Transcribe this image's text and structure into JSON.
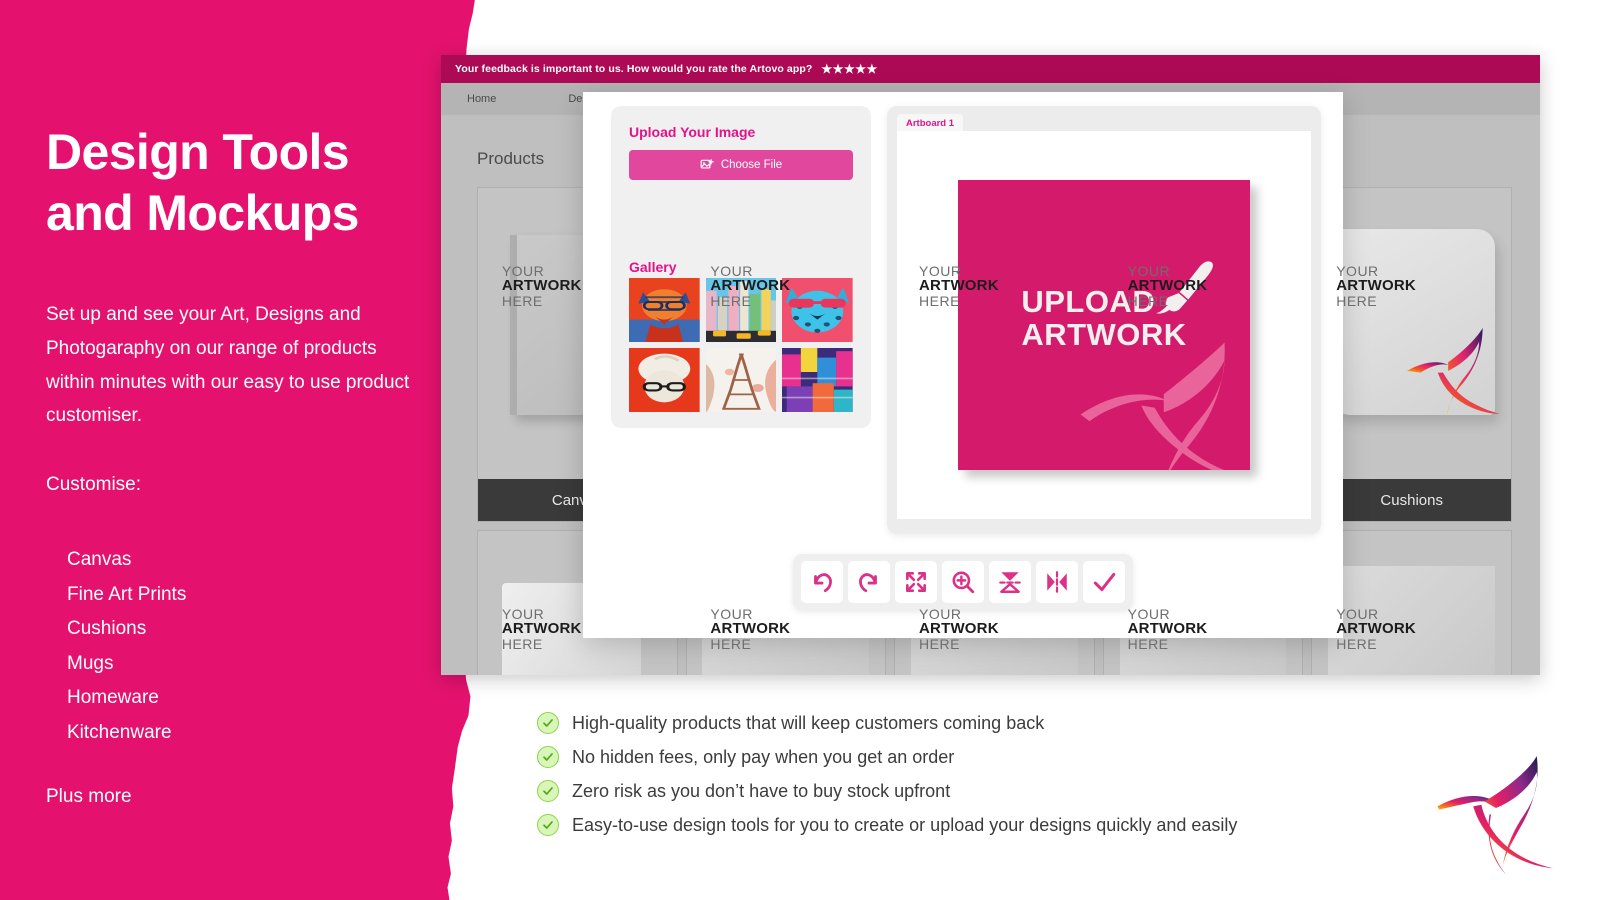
{
  "hero": {
    "title_line1": "Design Tools",
    "title_line2": "and Mockups",
    "body": "Set up and see your Art, Designs and Photogaraphy on our range of products within minutes with our easy to use product customiser.",
    "customise_label": "Customise:",
    "products": [
      "Canvas",
      "Fine Art Prints",
      "Cushions",
      "Mugs",
      "Homeware",
      "Kitchenware"
    ],
    "plus_more": "Plus more",
    "background_color": "#E4126E",
    "text_color": "#FFFFFF"
  },
  "app": {
    "feedback_bar": {
      "message": "Your feedback is important to us. How would you rate the Artovo app?",
      "stars": "★★★★★",
      "background_color": "#AD0A55"
    },
    "nav": {
      "items": [
        {
          "label": "Home"
        },
        {
          "label": "Designs"
        }
      ]
    },
    "products_heading": "Products",
    "artwork_placeholder": {
      "line1": "YOUR",
      "line2": "ARTWORK",
      "line3": "HERE"
    },
    "product_cards": [
      {
        "label": "Canvas",
        "mock": "canvas"
      },
      {
        "label": "",
        "mock": "generic"
      },
      {
        "label": "",
        "mock": "generic"
      },
      {
        "label": "",
        "mock": "generic"
      },
      {
        "label": "Cushions",
        "mock": "cushion"
      },
      {
        "label": "",
        "mock": "mug"
      },
      {
        "label": "",
        "mock": "generic"
      },
      {
        "label": "",
        "mock": "generic"
      },
      {
        "label": "",
        "mock": "generic"
      },
      {
        "label": "",
        "mock": "generic"
      }
    ]
  },
  "editor": {
    "upload": {
      "heading": "Upload Your Image",
      "choose_file_label": "Choose File",
      "button_color": "#E0479D"
    },
    "gallery": {
      "heading": "Gallery",
      "thumbnails": [
        {
          "name": "tiger-in-glasses"
        },
        {
          "name": "new-york-cityscape"
        },
        {
          "name": "blue-leopard-sunglasses"
        },
        {
          "name": "portrait-on-red"
        },
        {
          "name": "eiffel-tower-watercolour"
        },
        {
          "name": "abstract-city-collage"
        }
      ]
    },
    "artboard": {
      "tab_label": "Artboard 1",
      "canvas_line1": "UPLOAD",
      "canvas_line2": "ARTWORK",
      "canvas_color": "#D41A6A"
    },
    "toolbar": {
      "tools": [
        {
          "name": "undo",
          "title": "Undo"
        },
        {
          "name": "redo",
          "title": "Redo"
        },
        {
          "name": "expand",
          "title": "Fit to screen"
        },
        {
          "name": "zoom-in",
          "title": "Zoom in"
        },
        {
          "name": "flip-vertical",
          "title": "Flip vertical"
        },
        {
          "name": "flip-horizontal",
          "title": "Flip horizontal"
        },
        {
          "name": "confirm",
          "title": "Apply"
        }
      ],
      "icon_color": "#DB3188"
    }
  },
  "benefits": {
    "items": [
      "High-quality products that will keep customers coming back",
      "No hidden fees, only pay when you get an order",
      "Zero risk as you don’t have to buy stock upfront",
      "Easy-to-use design tools for you to create or upload your designs quickly and easily"
    ],
    "check_color": "#7CC242"
  },
  "brand": {
    "logo_name": "artovo-hummingbird-logo"
  }
}
